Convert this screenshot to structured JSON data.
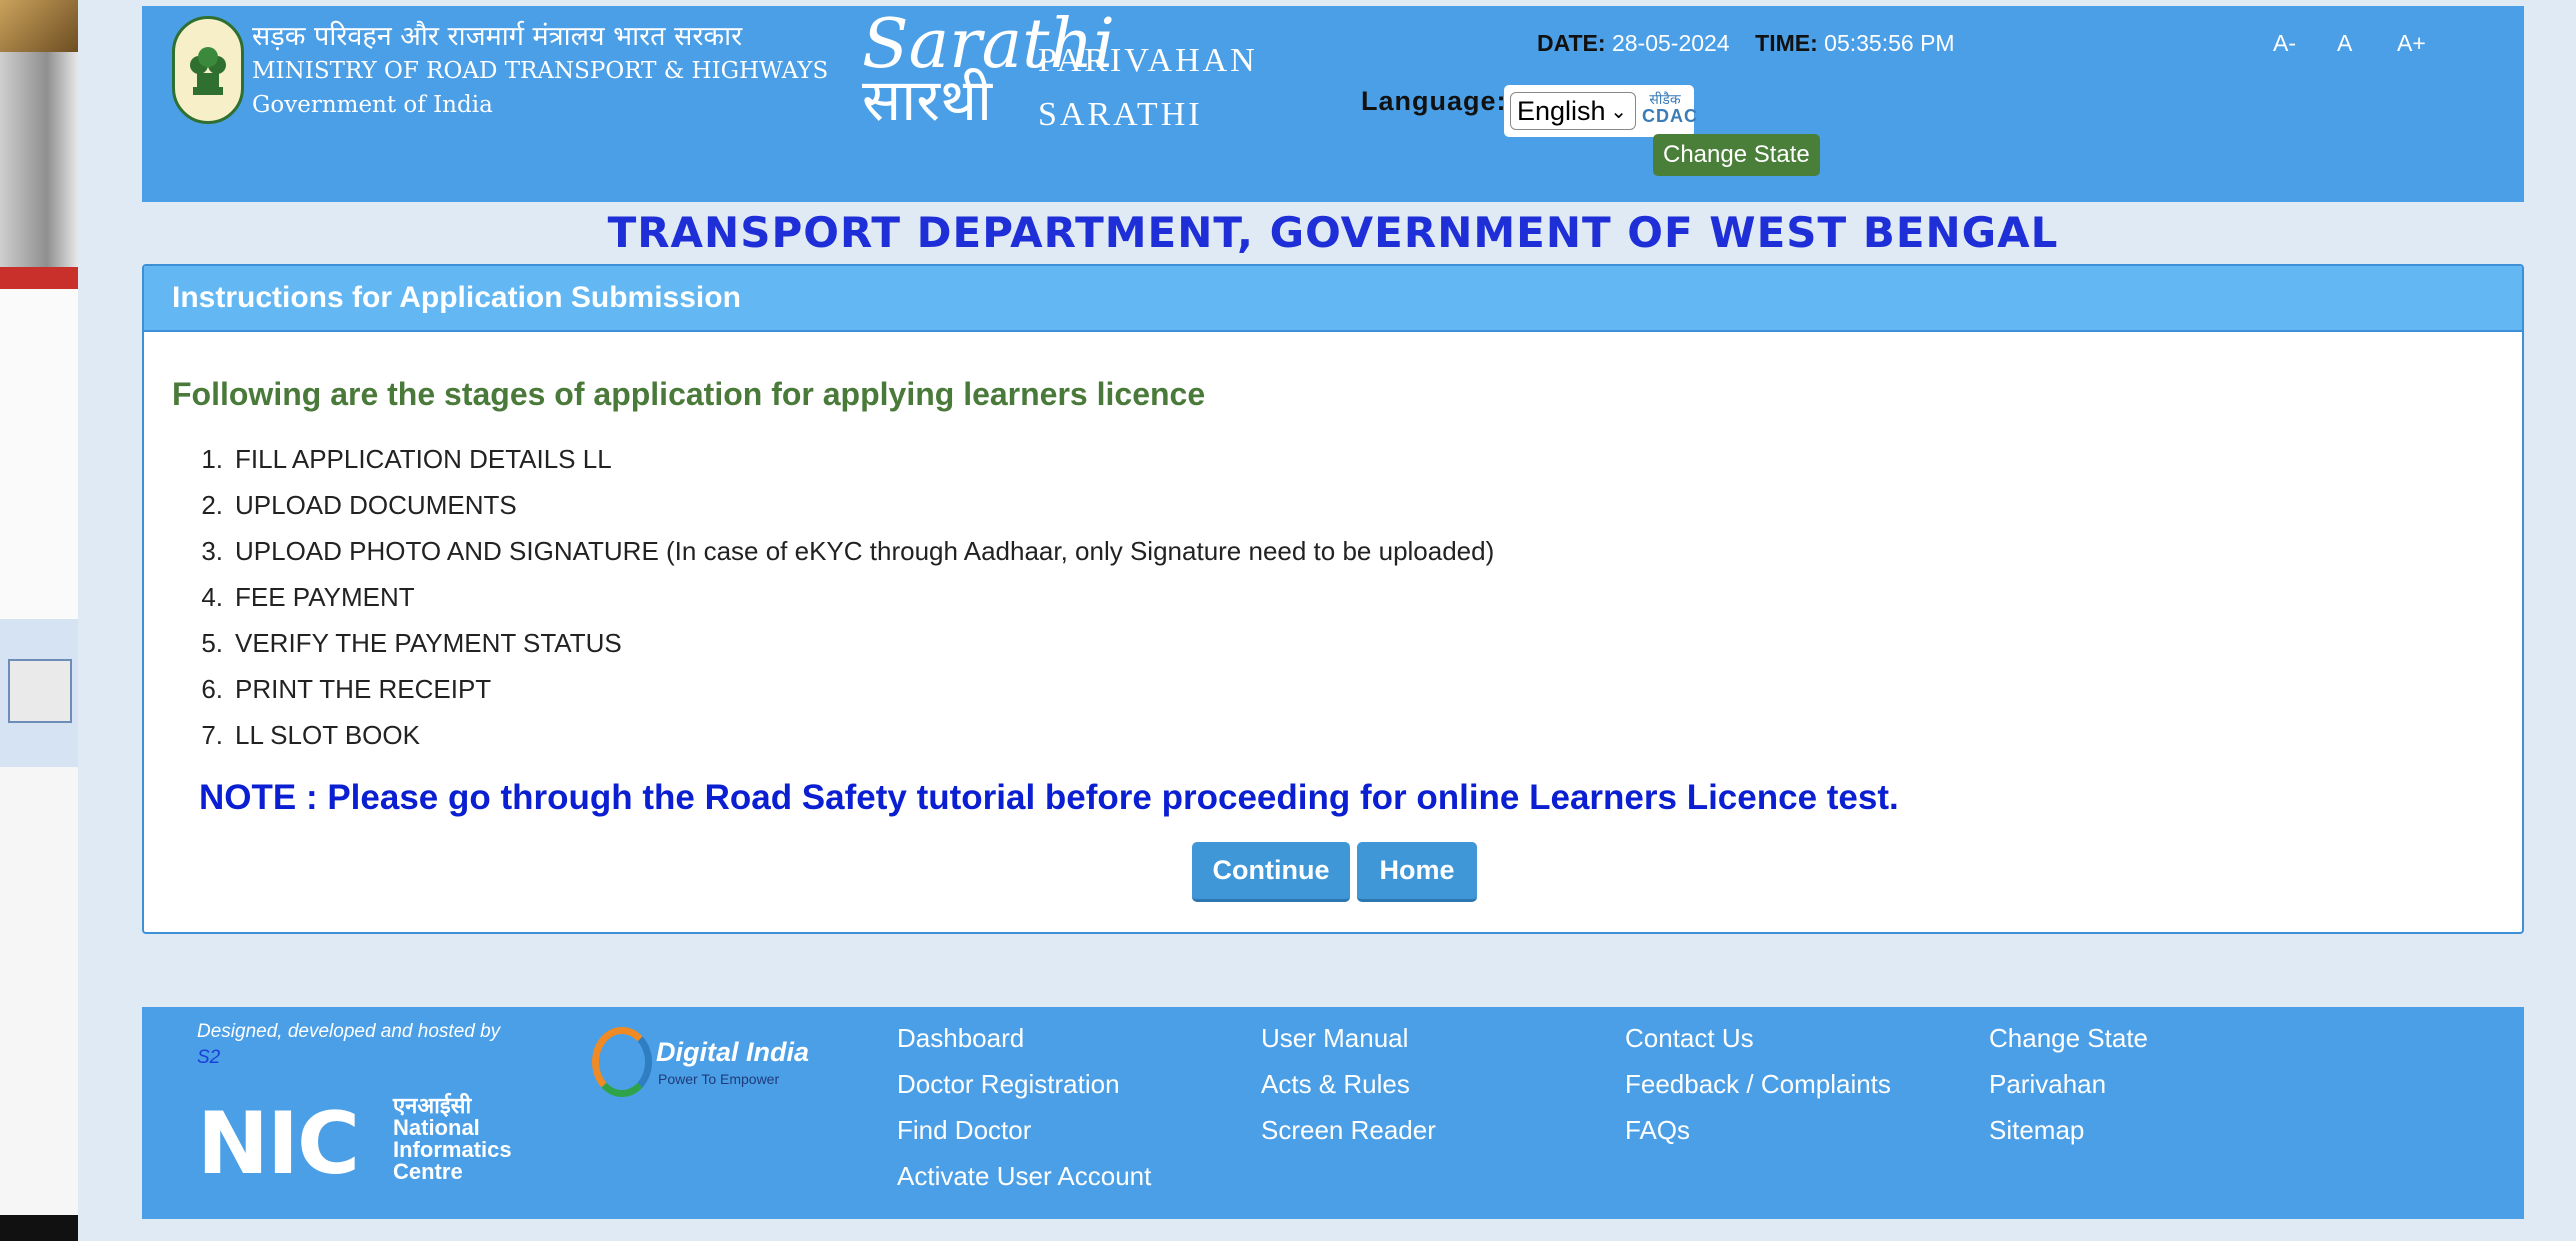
{
  "header": {
    "ministry_hindi": "सड़क परिवहन और राजमार्ग मंत्रालय भारत सरकार",
    "ministry_english": "MINISTRY OF ROAD TRANSPORT & HIGHWAYS",
    "government": "Government of India",
    "sarathi_logo_en": "Sarathi",
    "sarathi_logo_hi": "सारथी",
    "brand_line1": "PARIVAHAN",
    "brand_line2": "SARATHI",
    "date_label": "DATE:",
    "date_value": "28-05-2024",
    "time_label": "TIME:",
    "time_value": "05:35:56 PM",
    "font_small": "A-",
    "font_normal": "A",
    "font_large": "A+",
    "language_label": "Language:",
    "language_selected": "English",
    "cdac_line1": "सीडैक",
    "cdac_line2": "CDAC",
    "change_state": "Change State"
  },
  "department_title": "TRANSPORT DEPARTMENT, GOVERNMENT OF WEST BENGAL",
  "panel": {
    "title": "Instructions for Application Submission",
    "heading": "Following are the stages of application for applying learners licence",
    "stages": [
      {
        "num": "1.",
        "text": "FILL APPLICATION DETAILS LL"
      },
      {
        "num": "2.",
        "text": "UPLOAD DOCUMENTS"
      },
      {
        "num": "3.",
        "text": "UPLOAD PHOTO AND SIGNATURE (In case of eKYC through Aadhaar, only Signature need to be uploaded)"
      },
      {
        "num": "4.",
        "text": "FEE PAYMENT"
      },
      {
        "num": "5.",
        "text": "VERIFY THE PAYMENT STATUS"
      },
      {
        "num": "6.",
        "text": "PRINT THE RECEIPT"
      },
      {
        "num": "7.",
        "text": "LL SLOT BOOK"
      }
    ],
    "note": "NOTE : Please go through the Road Safety tutorial before proceeding for online Learners Licence test.",
    "continue_label": "Continue",
    "home_label": "Home"
  },
  "footer": {
    "designed_by": "Designed, developed and hosted by",
    "designed_by_suffix": "S2",
    "nic_letters": "NIC",
    "nic_hindi": "एनआईसी",
    "nic_line1": "National",
    "nic_line2": "Informatics",
    "nic_line3": "Centre",
    "digital_india": "Digital India",
    "digital_india_tagline": "Power To Empower",
    "links": {
      "dashboard": "Dashboard",
      "doctor_registration": "Doctor Registration",
      "find_doctor": "Find Doctor",
      "activate_user_account": "Activate User Account",
      "user_manual": "User Manual",
      "acts_rules": "Acts & Rules",
      "screen_reader": "Screen Reader",
      "contact_us": "Contact Us",
      "feedback_complaints": "Feedback / Complaints",
      "faqs": "FAQs",
      "change_state": "Change State",
      "parivahan": "Parivahan",
      "sitemap": "Sitemap"
    }
  },
  "colors": {
    "header_blue": "#4b9fe6",
    "panel_head": "#63b8f3",
    "title_blue": "#1f2fd8",
    "heading_green": "#4a7a3a",
    "note_blue": "#0a1ed2",
    "button_blue": "#3f97d8",
    "change_state_green": "#4a7f3a"
  }
}
